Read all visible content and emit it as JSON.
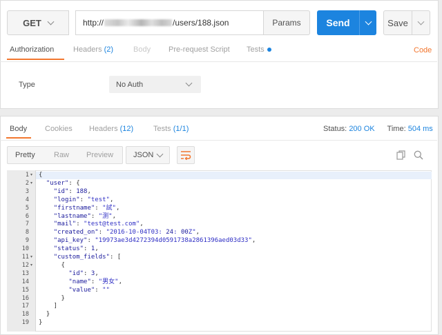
{
  "request": {
    "method": "GET",
    "url_prefix": "http://",
    "url_suffix": "/users/188.json",
    "params_label": "Params",
    "send_label": "Send",
    "save_label": "Save"
  },
  "request_tabs": {
    "authorization": "Authorization",
    "headers": "Headers",
    "headers_count": "(2)",
    "body": "Body",
    "pre_request": "Pre-request Script",
    "tests": "Tests",
    "code": "Code"
  },
  "auth": {
    "type_label": "Type",
    "type_value": "No Auth"
  },
  "response_tabs": {
    "body": "Body",
    "cookies": "Cookies",
    "headers": "Headers",
    "headers_count": "(12)",
    "tests": "Tests",
    "tests_count": "(1/1)"
  },
  "response_status": {
    "status_label": "Status:",
    "status_value": "200 OK",
    "time_label": "Time:",
    "time_value": "504 ms"
  },
  "view_modes": {
    "pretty": "Pretty",
    "raw": "Raw",
    "preview": "Preview",
    "format": "JSON"
  },
  "colors": {
    "accent_orange": "#f2762e",
    "primary_blue": "#1c84df"
  },
  "code_lines": [
    "{",
    "  \"user\": {",
    "    \"id\": 188,",
    "    \"login\": \"test\",",
    "    \"firstname\": \"試\",",
    "    \"lastname\": \"测\",",
    "    \"mail\": \"test@test.com\",",
    "    \"created_on\": \"2016-10-04T03:24:00Z\",",
    "    \"api_key\": \"19973ae3d4272394d0591738a2861396aed03d33\",",
    "    \"status\": 1,",
    "    \"custom_fields\": [",
    "      {",
    "        \"id\": 3,",
    "        \"name\": \"男女\",",
    "        \"value\": \"\"",
    "      }",
    "    ]",
    "  }",
    "}"
  ],
  "line_numbers": [
    "1",
    "2",
    "3",
    "4",
    "5",
    "6",
    "7",
    "8",
    "9",
    "10",
    "11",
    "12",
    "13",
    "14",
    "15",
    "16",
    "17",
    "18",
    "19"
  ]
}
